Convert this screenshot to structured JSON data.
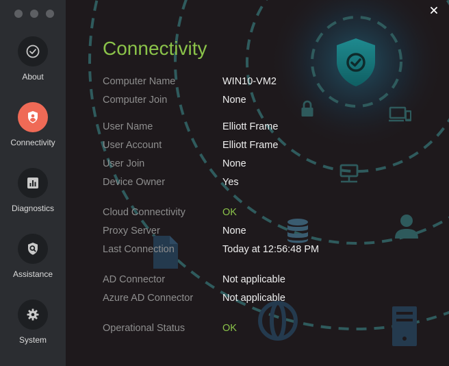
{
  "window": {
    "close_glyph": "✕"
  },
  "sidebar": {
    "items": [
      {
        "label": "About",
        "icon": "check-circle-icon",
        "active": false
      },
      {
        "label": "Connectivity",
        "icon": "shield-user-icon",
        "active": true
      },
      {
        "label": "Diagnostics",
        "icon": "bar-chart-icon",
        "active": false
      },
      {
        "label": "Assistance",
        "icon": "shield-search-icon",
        "active": false
      },
      {
        "label": "System",
        "icon": "gear-icon",
        "active": false
      }
    ]
  },
  "main": {
    "title": "Connectivity",
    "fields": [
      {
        "label": "Computer Name",
        "value": "WIN10-VM2"
      },
      {
        "label": "Computer Join",
        "value": "None"
      },
      {
        "label": "User Name",
        "value": "Elliott Frame"
      },
      {
        "label": "User Account",
        "value": "Elliott Frame"
      },
      {
        "label": "User Join",
        "value": "None"
      },
      {
        "label": "Device Owner",
        "value": "Yes"
      },
      {
        "label": "Cloud Connectivity",
        "value": "OK",
        "status": "ok"
      },
      {
        "label": "Proxy Server",
        "value": "None"
      },
      {
        "label": "Last Connection",
        "value": "Today at 12:56:48 PM"
      },
      {
        "label": "AD Connector",
        "value": "Not applicable"
      },
      {
        "label": "Azure AD Connector",
        "value": "Not applicable"
      },
      {
        "label": "Operational Status",
        "value": "OK",
        "status": "ok"
      }
    ]
  },
  "colors": {
    "accent_green": "#8bc34a",
    "active_nav": "#ef6a56",
    "sidebar_bg": "#2b2d31",
    "main_bg": "#1e191c",
    "decor_teal": "#2f5b5d"
  }
}
